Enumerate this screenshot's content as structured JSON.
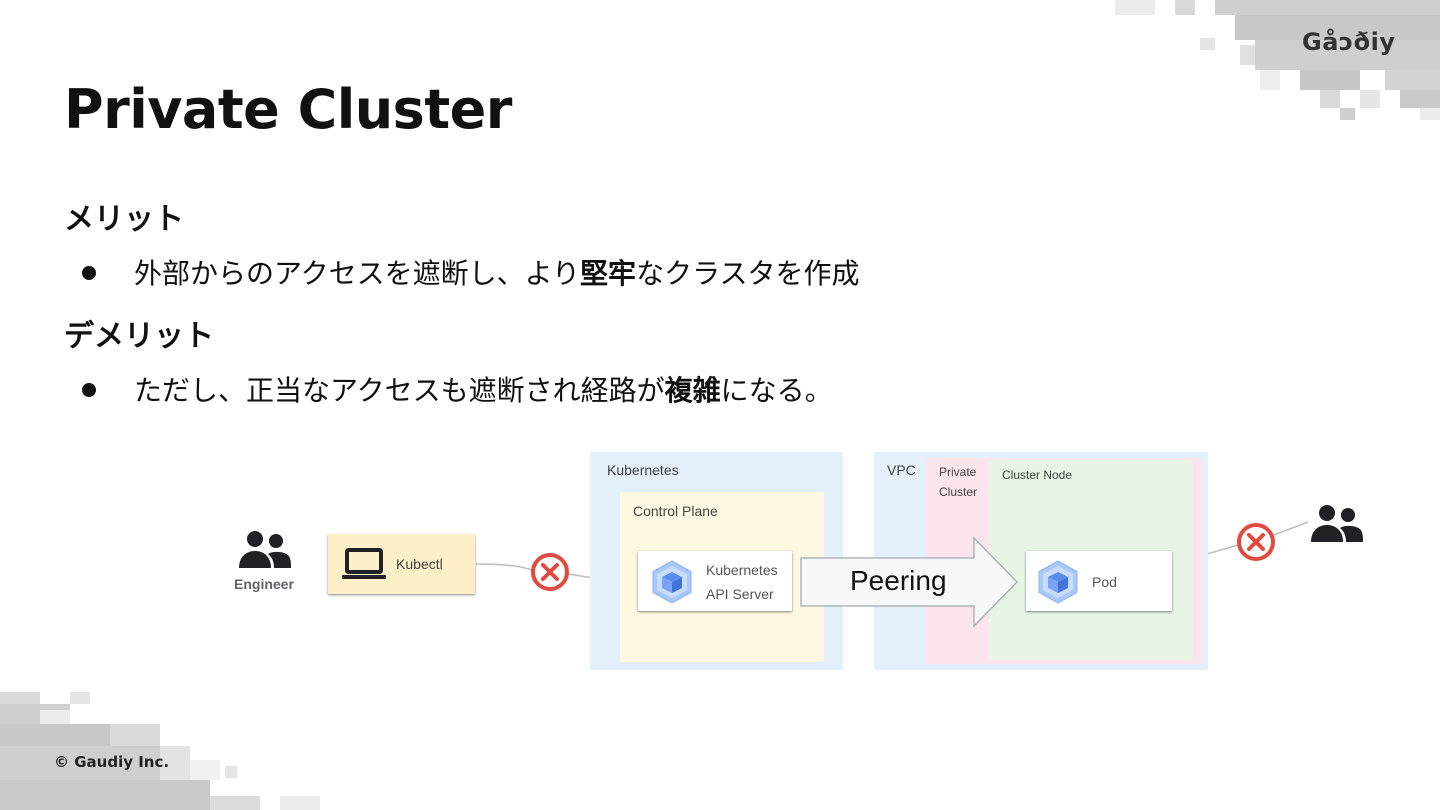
{
  "slide": {
    "title": "Private Cluster",
    "logo_text": "Gåɔðiy",
    "copyright": "© Gaudiy Inc."
  },
  "sections": [
    {
      "heading": "メリット",
      "bullet_parts": [
        {
          "text": "外部からのアクセスを遮断し、より",
          "bold": false
        },
        {
          "text": "堅牢",
          "bold": true
        },
        {
          "text": "なクラスタを作成",
          "bold": false
        }
      ]
    },
    {
      "heading": "デメリット",
      "bullet_parts": [
        {
          "text": "ただし、正当なアクセスも遮断され経路が",
          "bold": false
        },
        {
          "text": "複雑",
          "bold": true
        },
        {
          "text": "になる。",
          "bold": false
        }
      ]
    }
  ],
  "diagram": {
    "engineer_label": "Engineer",
    "kubectl_label": "Kubectl",
    "kubernetes_label": "Kubernetes",
    "control_plane_label": "Control Plane",
    "api_server_line1": "Kubernetes",
    "api_server_line2": "API Server",
    "peering_label": "Peering",
    "vpc_label": "VPC",
    "private_cluster_line1": "Private",
    "private_cluster_line2": "Cluster",
    "cluster_node_label": "Cluster Node",
    "pod_label": "Pod",
    "colors": {
      "kubernetes_bg": "#e3f0fb",
      "control_plane_bg": "#fdf8e1",
      "vpc_bg": "#e3f0fb",
      "private_cluster_bg": "#fbe4ec",
      "cluster_node_bg": "#e7f4e6",
      "kubectl_bg": "#fdefc7",
      "blocked_red": "#e04a3f",
      "k8s_blue": "#8ab4f8"
    }
  }
}
